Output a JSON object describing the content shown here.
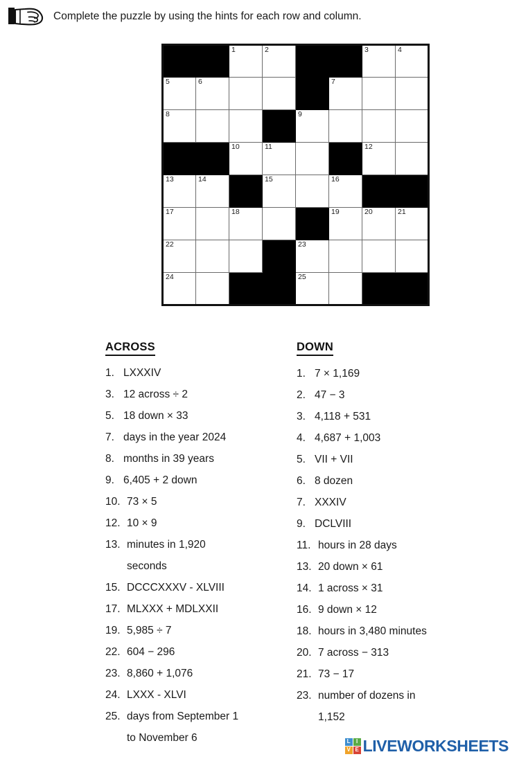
{
  "instruction": {
    "icon": "pointing-hand-icon",
    "text": "Complete the puzzle by using the hints for each row and column."
  },
  "grid": {
    "rows": 8,
    "cols": 8,
    "block_color": "#000000",
    "cell_color": "#ffffff",
    "border_color": "#111111",
    "cells": [
      [
        {
          "block": true
        },
        {
          "block": true
        },
        {
          "num": "1"
        },
        {
          "num": "2"
        },
        {
          "block": true
        },
        {
          "block": true
        },
        {
          "num": "3"
        },
        {
          "num": "4"
        }
      ],
      [
        {
          "num": "5"
        },
        {
          "num": "6"
        },
        {},
        {},
        {
          "block": true
        },
        {
          "num": "7"
        },
        {},
        {}
      ],
      [
        {
          "num": "8"
        },
        {},
        {},
        {
          "block": true
        },
        {
          "num": "9"
        },
        {},
        {},
        {}
      ],
      [
        {
          "block": true
        },
        {
          "block": true
        },
        {
          "num": "10"
        },
        {
          "num": "11"
        },
        {},
        {
          "block": true
        },
        {
          "num": "12"
        },
        {}
      ],
      [
        {
          "num": "13"
        },
        {
          "num": "14"
        },
        {
          "block": true
        },
        {
          "num": "15"
        },
        {},
        {
          "num": "16"
        },
        {
          "block": true
        },
        {
          "block": true
        }
      ],
      [
        {
          "num": "17"
        },
        {},
        {
          "num": "18"
        },
        {},
        {
          "block": true
        },
        {
          "num": "19"
        },
        {
          "num": "20"
        },
        {
          "num": "21"
        }
      ],
      [
        {
          "num": "22"
        },
        {},
        {},
        {
          "block": true
        },
        {
          "num": "23"
        },
        {},
        {},
        {}
      ],
      [
        {
          "num": "24"
        },
        {},
        {
          "block": true
        },
        {
          "block": true
        },
        {
          "num": "25"
        },
        {},
        {
          "block": true
        },
        {
          "block": true
        }
      ]
    ]
  },
  "across": {
    "heading": "ACROSS",
    "clues": [
      {
        "num": "1.",
        "text": "LXXXIV"
      },
      {
        "num": "3.",
        "text": "12 across ÷ 2"
      },
      {
        "num": "5.",
        "text": "18 down × 33"
      },
      {
        "num": "7.",
        "text": "days in the year 2024"
      },
      {
        "num": "8.",
        "text": "months in 39 years"
      },
      {
        "num": "9.",
        "text": "6,405 + 2 down"
      },
      {
        "num": "10.",
        "text": "73 × 5"
      },
      {
        "num": "12.",
        "text": "10 × 9"
      },
      {
        "num": "13.",
        "text": "minutes in 1,920",
        "cont": "seconds"
      },
      {
        "num": "15.",
        "text": "DCCCXXXV - XLVIII"
      },
      {
        "num": "17.",
        "text": "MLXXX + MDLXXII"
      },
      {
        "num": "19.",
        "text": "5,985 ÷ 7"
      },
      {
        "num": "22.",
        "text": "604 − 296"
      },
      {
        "num": "23.",
        "text": "8,860 + 1,076"
      },
      {
        "num": "24.",
        "text": "LXXX - XLVI"
      },
      {
        "num": "25.",
        "text": "days from September 1",
        "cont": "to November 6"
      }
    ]
  },
  "down": {
    "heading": "DOWN",
    "clues": [
      {
        "num": "1.",
        "text": "7 × 1,169"
      },
      {
        "num": "2.",
        "text": "47 − 3"
      },
      {
        "num": "3.",
        "text": "4,118 + 531"
      },
      {
        "num": "4.",
        "text": "4,687 + 1,003"
      },
      {
        "num": "5.",
        "text": "VII + VII"
      },
      {
        "num": "6.",
        "text": "8 dozen"
      },
      {
        "num": "7.",
        "text": "XXXIV"
      },
      {
        "num": "9.",
        "text": "DCLVIII"
      },
      {
        "num": "11.",
        "text": "hours in 28 days"
      },
      {
        "num": "13.",
        "text": "20 down × 61"
      },
      {
        "num": "14.",
        "text": "1 across × 31"
      },
      {
        "num": "16.",
        "text": "9 down × 12"
      },
      {
        "num": "18.",
        "text": "hours in 3,480 minutes"
      },
      {
        "num": "20.",
        "text": "7 across − 313"
      },
      {
        "num": "21.",
        "text": "73 − 17"
      },
      {
        "num": "23.",
        "text": "number of dozens in",
        "cont": "1,152"
      }
    ]
  },
  "footer": {
    "brand": "LIVEWORKSHEETS",
    "brand_color": "#1f5fa8",
    "logo_tiles": [
      {
        "letter": "L",
        "color": "#3f8fd0"
      },
      {
        "letter": "I",
        "color": "#5aab46"
      },
      {
        "letter": "V",
        "color": "#f0a32a"
      },
      {
        "letter": "E",
        "color": "#d84437"
      }
    ]
  }
}
